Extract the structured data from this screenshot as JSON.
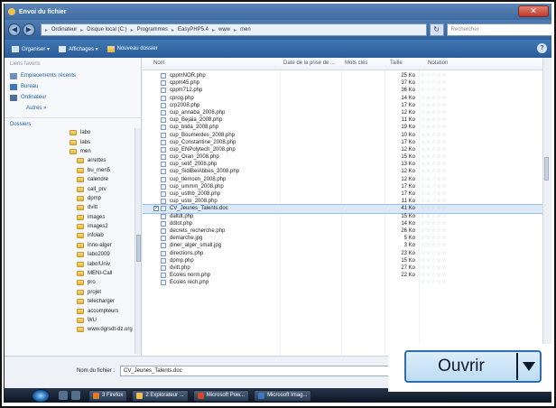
{
  "window": {
    "title": "Envoi du fichier",
    "close_glyph": "✕"
  },
  "address": {
    "crumbs": [
      "Ordinateur",
      "Disque local (C:)",
      "Programmes",
      "EasyPHP5.4",
      "www",
      "men"
    ],
    "separator": "▸",
    "search_placeholder": "Rechercher",
    "back_glyph": "◀",
    "forward_glyph": "▶",
    "refresh_glyph": "↻"
  },
  "toolbar": {
    "organize": "Organiser ▾",
    "views": "Affichages ▾",
    "new_folder": "Nouveau dossier",
    "help_glyph": "?"
  },
  "nav": {
    "favorites_header": "Liens favoris",
    "favorites": [
      {
        "label": "Emplacements récents",
        "icon": "recent-places-icon"
      },
      {
        "label": "Bureau",
        "icon": "desktop-icon"
      },
      {
        "label": "Ordinateur",
        "icon": "computer-icon"
      }
    ],
    "more": "Autres »",
    "folders_header": "Dossiers",
    "tree": [
      {
        "label": "labo",
        "indent": 72
      },
      {
        "label": "labs",
        "indent": 72
      },
      {
        "label": "men",
        "indent": 72
      },
      {
        "label": "arrettes",
        "indent": 80
      },
      {
        "label": "bu_men5",
        "indent": 80
      },
      {
        "label": "calendre",
        "indent": 80
      },
      {
        "label": "call_prv",
        "indent": 80
      },
      {
        "label": "dpmp",
        "indent": 80
      },
      {
        "label": "dvitt",
        "indent": 80
      },
      {
        "label": "images",
        "indent": 80
      },
      {
        "label": "images2",
        "indent": 80
      },
      {
        "label": "infolab",
        "indent": 80
      },
      {
        "label": "inno-alger",
        "indent": 80
      },
      {
        "label": "labo2009",
        "indent": 80
      },
      {
        "label": "labo!Univ",
        "indent": 80
      },
      {
        "label": "MENI-Call",
        "indent": 80
      },
      {
        "label": "pro",
        "indent": 80
      },
      {
        "label": "projet",
        "indent": 80
      },
      {
        "label": "telecharger",
        "indent": 80
      },
      {
        "label": "accompteurs",
        "indent": 80
      },
      {
        "label": "WU",
        "indent": 80
      },
      {
        "label": "www.dgrsdt-dz.org",
        "indent": 80
      }
    ]
  },
  "columns": {
    "name": "Nom",
    "date": "Date de la prise de ...",
    "tags": "Mots clés",
    "size": "Taille",
    "rating": "Notation"
  },
  "files": [
    {
      "name": "cppmNOR.php",
      "size": "25 Ko",
      "selected": false
    },
    {
      "name": "cppm45.php",
      "size": "37 Ko",
      "selected": false
    },
    {
      "name": "cppm712.php",
      "size": "36 Ko",
      "selected": false
    },
    {
      "name": "cprog.php",
      "size": "14 Ko",
      "selected": false
    },
    {
      "name": "crp2008.php",
      "size": "17 Ko",
      "selected": false
    },
    {
      "name": "cup_annaba_2008.php",
      "size": "12 Ko",
      "selected": false
    },
    {
      "name": "cup_Bejaia_2008.php",
      "size": "11 Ko",
      "selected": false
    },
    {
      "name": "cup_blida_2008.php",
      "size": "19 Ko",
      "selected": false
    },
    {
      "name": "cup_Boumerdes_2008.php",
      "size": "10 Ko",
      "selected": false
    },
    {
      "name": "cup_Constantine_2008.php",
      "size": "17 Ko",
      "selected": false
    },
    {
      "name": "cup_ENPolytech_2008.php",
      "size": "12 Ko",
      "selected": false
    },
    {
      "name": "cup_Oran_2008.php",
      "size": "15 Ko",
      "selected": false
    },
    {
      "name": "cup_setif_2008.php",
      "size": "13 Ko",
      "selected": false
    },
    {
      "name": "cup_SidiBelAbbes_2008.php",
      "size": "12 Ko",
      "selected": false
    },
    {
      "name": "cup_tlemcen_2008.php",
      "size": "12 Ko",
      "selected": false
    },
    {
      "name": "cup_ummm_2008.php",
      "size": "17 Ko",
      "selected": false
    },
    {
      "name": "cup_usthb_2008.php",
      "size": "17 Ko",
      "selected": false
    },
    {
      "name": "cup_usto_2008.php",
      "size": "11 Ko",
      "selected": false
    },
    {
      "name": "CV_Jeunes_Talents.doc",
      "size": "41 Ko",
      "selected": true
    },
    {
      "name": "daltdt.php",
      "size": "15 Ko",
      "selected": false
    },
    {
      "name": "ddtot.php",
      "size": "14 Ko",
      "selected": false
    },
    {
      "name": "decrets_recherche.php",
      "size": "26 Ko",
      "selected": false
    },
    {
      "name": "demarche.jpg",
      "size": "5 Ko",
      "selected": false
    },
    {
      "name": "diner_alger_small.jpg",
      "size": "3 Ko",
      "selected": false
    },
    {
      "name": "directions.php",
      "size": "23 Ko",
      "selected": false
    },
    {
      "name": "dpmp.php",
      "size": "15 Ko",
      "selected": false
    },
    {
      "name": "dvitt.php",
      "size": "27 Ko",
      "selected": false
    },
    {
      "name": "Ecoles norm.php",
      "size": "22 Ko",
      "selected": false
    },
    {
      "name": "Ecoles rech.php",
      "size": "",
      "selected": false
    }
  ],
  "rating_glyphs": "☆☆☆☆☆",
  "selected_mark": "✓",
  "bottom": {
    "filename_label": "Nom du fichier :",
    "filename_value": "CV_Jeunes_Talents.doc",
    "open_label": "Ouvrir"
  },
  "taskbar": {
    "tasks": [
      {
        "label": "3 Firefox",
        "color": "#e07a28"
      },
      {
        "label": "2 Explorateur ...",
        "color": "#f0c050"
      },
      {
        "label": "Microsoft Pow...",
        "color": "#d24726"
      },
      {
        "label": "Microsoft Imag...",
        "color": "#3c78c0"
      }
    ]
  }
}
